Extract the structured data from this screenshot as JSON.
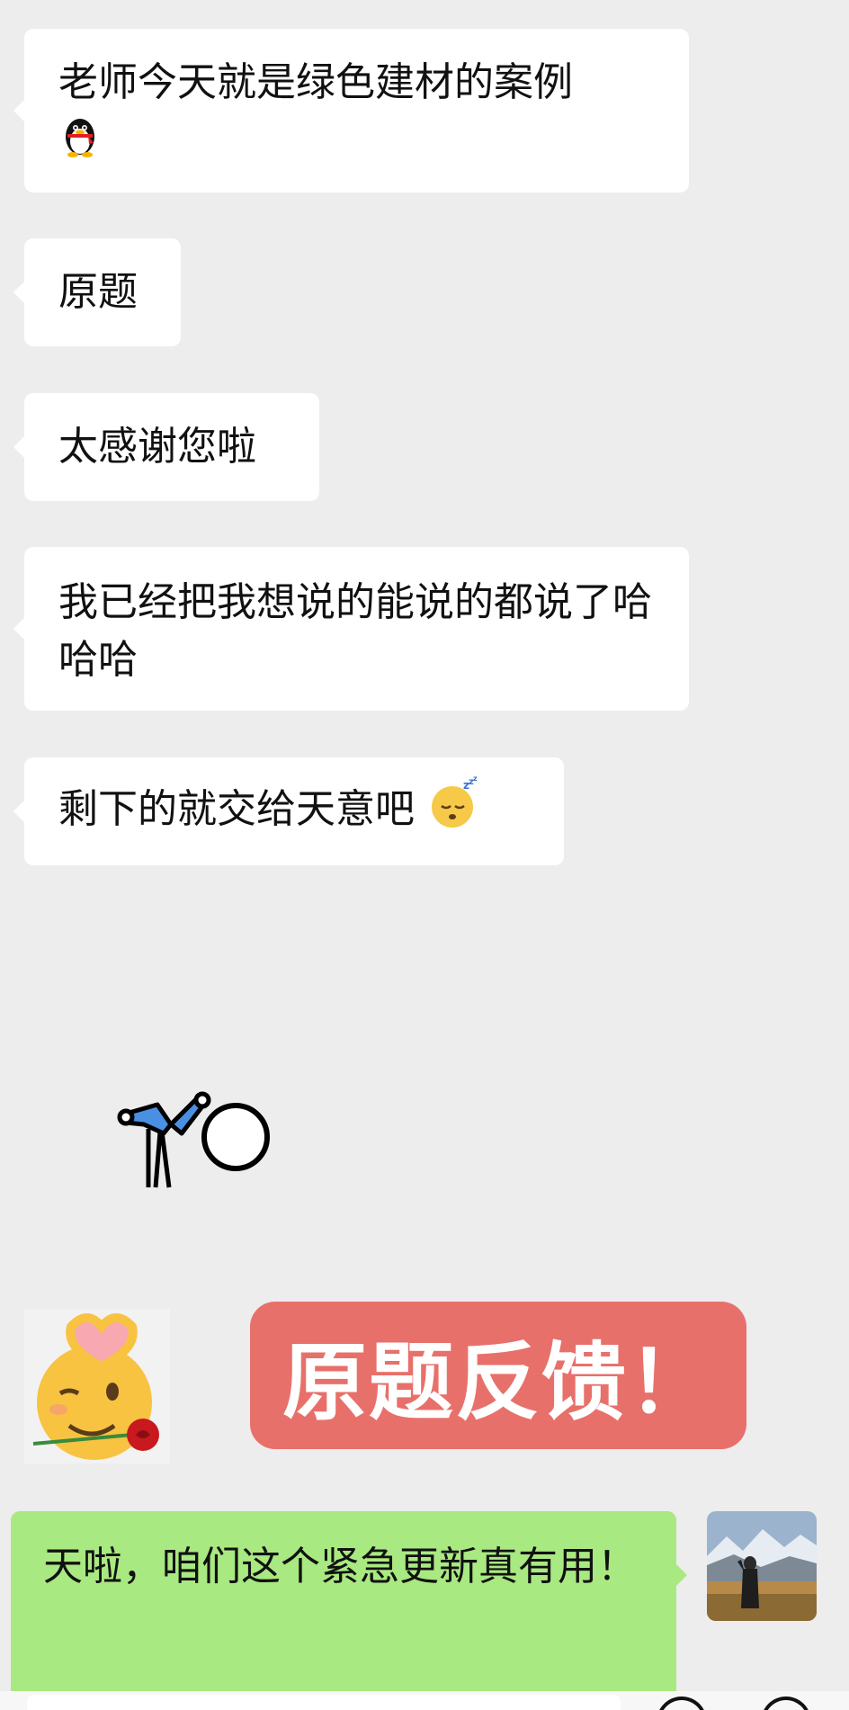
{
  "messages": [
    {
      "text": "老师今天就是绿色建材的案例",
      "emoji": "penguin-icon"
    },
    {
      "text": "原题"
    },
    {
      "text": "太感谢您啦"
    },
    {
      "text": "我已经把我想说的能说的都说了哈哈哈"
    },
    {
      "text": "剩下的就交给天意吧",
      "emoji": "sleeping-face-icon"
    }
  ],
  "stickers": {
    "dancer": "stick-figure-sticker",
    "face": "wink-heart-rose-emoji"
  },
  "banner": {
    "text": "原题反馈！",
    "color": "#e8706b"
  },
  "outgoing": {
    "text": "天啦，咱们这个紧急更新真有用！",
    "color": "#a9e981"
  },
  "colors": {
    "background": "#ededed",
    "bubble_in": "#ffffff"
  }
}
